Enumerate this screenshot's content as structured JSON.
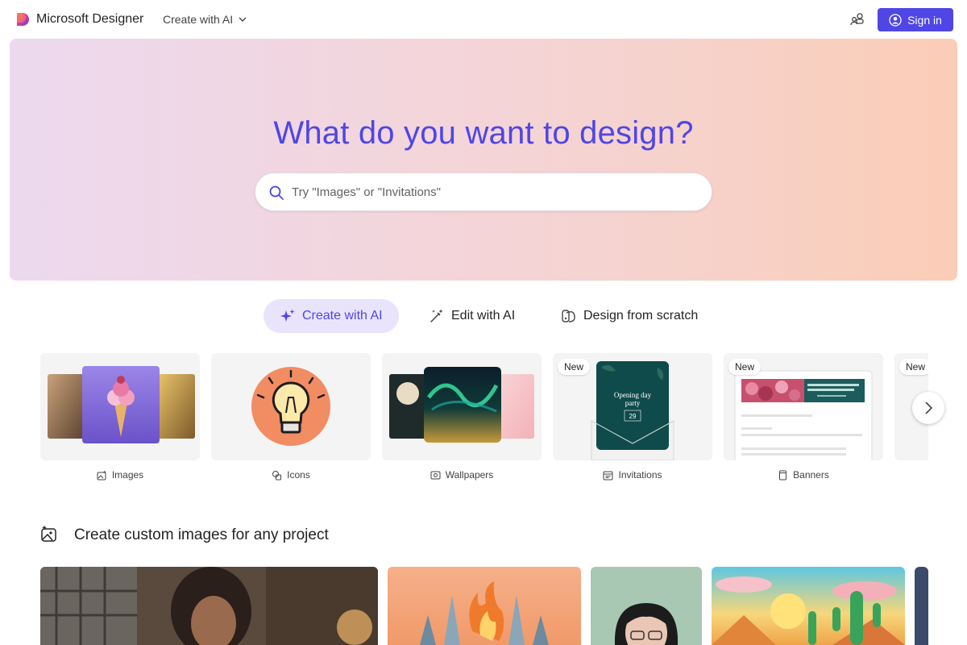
{
  "header": {
    "brand": "Microsoft Designer",
    "mode_menu": "Create with AI",
    "sign_in": "Sign in"
  },
  "hero": {
    "title": "What do you want to design?",
    "search_placeholder": "Try \"Images\" or \"Invitations\""
  },
  "tabs": [
    {
      "label": "Create with AI",
      "icon": "sparkle-icon",
      "active": true
    },
    {
      "label": "Edit with AI",
      "icon": "magic-wand-icon",
      "active": false
    },
    {
      "label": "Design from scratch",
      "icon": "palette-icon",
      "active": false
    }
  ],
  "categories": [
    {
      "label": "Images",
      "icon": "image-sparkle-icon",
      "badge": ""
    },
    {
      "label": "Icons",
      "icon": "shapes-icon",
      "badge": ""
    },
    {
      "label": "Wallpapers",
      "icon": "wallpaper-icon",
      "badge": ""
    },
    {
      "label": "Invitations",
      "icon": "calendar-icon",
      "badge": "New",
      "preview_title": "Opening day party",
      "preview_date": "29"
    },
    {
      "label": "Banners",
      "icon": "banner-icon",
      "badge": "New",
      "preview_title": "Revolutionizing Urban Mobility: A Smart City Initiative"
    },
    {
      "label": "",
      "icon": "",
      "badge": "New"
    }
  ],
  "section": {
    "title": "Create custom images for any project",
    "icon": "image-sparkle-icon"
  },
  "colors": {
    "accent": "#4f46e5",
    "accent_soft": "#e9e4fb",
    "hero_left": "#ecd9ef",
    "hero_right": "#fbcdb6"
  }
}
